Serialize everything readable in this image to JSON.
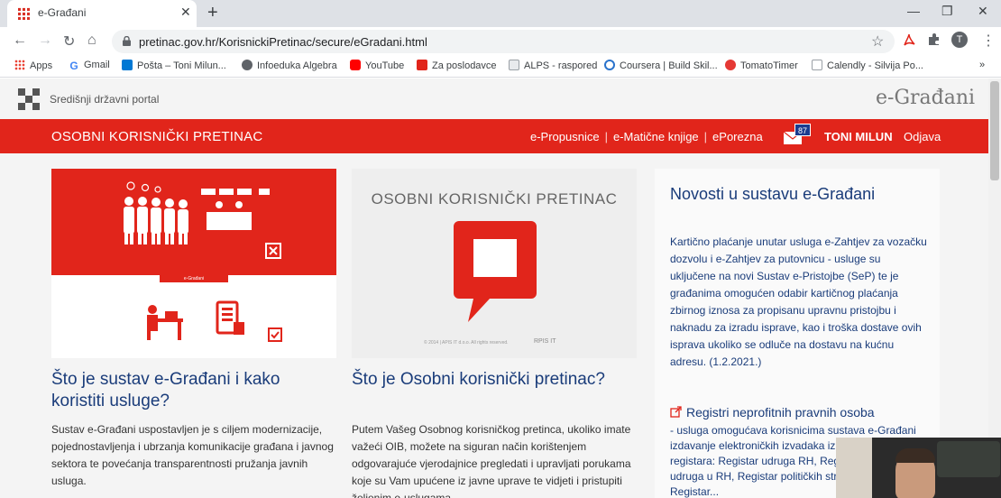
{
  "browser": {
    "tab_title": "e-Građani",
    "tab_close": "✕",
    "new_tab": "+",
    "window_controls": [
      "—",
      "❐",
      "✕"
    ],
    "url": "pretinac.gov.hr/KorisnickiPretinac/secure/eGradani.html",
    "avatar_initial": "T",
    "bookmarks": [
      {
        "label": "Apps",
        "icon": "apps-grid-icon",
        "color": "#4285f4"
      },
      {
        "label": "Gmail",
        "icon": "google-icon",
        "color": "#4285f4"
      },
      {
        "label": "Pošta – Toni Milun...",
        "icon": "outlook-icon",
        "color": "#0078d4"
      },
      {
        "label": "Infoeduka Algebra",
        "icon": "globe-icon",
        "color": "#5f6368"
      },
      {
        "label": "YouTube",
        "icon": "youtube-icon",
        "color": "#ff0000"
      },
      {
        "label": "Za poslodavce",
        "icon": "mp-icon",
        "color": "#e1251b"
      },
      {
        "label": "ALPS - raspored",
        "icon": "doc-icon",
        "color": "#9aa0a6"
      },
      {
        "label": "Coursera | Build Skil...",
        "icon": "coursera-icon",
        "color": "#2a73cc"
      },
      {
        "label": "TomatoTimer",
        "icon": "tomato-icon",
        "color": "#e53935"
      },
      {
        "label": "Calendly - Silvija Po...",
        "icon": "calendly-icon",
        "color": "#9aa0a6"
      }
    ],
    "bookmarks_more": "»"
  },
  "portal": {
    "name": "Središnji državni portal",
    "brand": "e-Građani"
  },
  "header": {
    "section_title": "OSOBNI KORISNIČKI PRETINAC",
    "links": [
      "e-Propusnice",
      "e-Matične knjige",
      "ePorezna"
    ],
    "separator": "|",
    "mail_count": "87",
    "user_name": "TONI MILUN",
    "logout": "Odjava"
  },
  "cards": [
    {
      "title": "Što je sustav e-Građani i kako koristiti usluge?",
      "image_banner": "e-Građani",
      "text": "Sustav e-Građani uspostavljen je s ciljem modernizacije, pojednostavljenja i ubrzanja komunikacije građana i javnog sektora te povećanja transparentnosti pružanja javnih usluga."
    },
    {
      "title": "Što je Osobni korisnički pretinac?",
      "image_heading": "OSOBNI KORISNIČKI PRETINAC",
      "image_footer": "© 2014 | APIS IT d.o.o. All rights reserved.",
      "image_mark": "RPIS IT",
      "text": "Putem Vašeg Osobnog korisničkog pretinca, ukoliko imate važeći OIB, možete na siguran način korištenjem odgovarajuće vjerodajnice pregledati i upravljati porukama koje su Vam upućene iz javne uprave te vidjeti i pristupiti željenim e-uslugama."
    }
  ],
  "news": {
    "title": "Novosti u sustavu e-Građani",
    "item1": "Kartično plaćanje unutar usluga e-Zahtjev za vozačku dozvolu i e-Zahtjev za putovnicu - usluge su uključene na novi Sustav e-Pristojbe (SeP) te je građanima omogućen odabir kartičnog plaćanja zbirnog iznosa za propisanu upravnu pristojbu i naknadu za izradu isprave, kao i troška dostave ovih isprava ukoliko se odluče na dostavu na kućnu adresu. (1.2.2021.)",
    "item2_title": "Registri neprofitnih pravnih osoba",
    "item2_text": "- usluga omogućava korisnicima sustava e-Građani izdavanje elektroničkih izvadaka iz sljedećih registara: Registar udruga RH, Registar stranih udruga u RH, Registar političkih stranaka RH, Registar..."
  },
  "colors": {
    "brand_red": "#e1251b",
    "title_blue": "#1a3c7a",
    "badge_blue": "#1a3b8f"
  }
}
